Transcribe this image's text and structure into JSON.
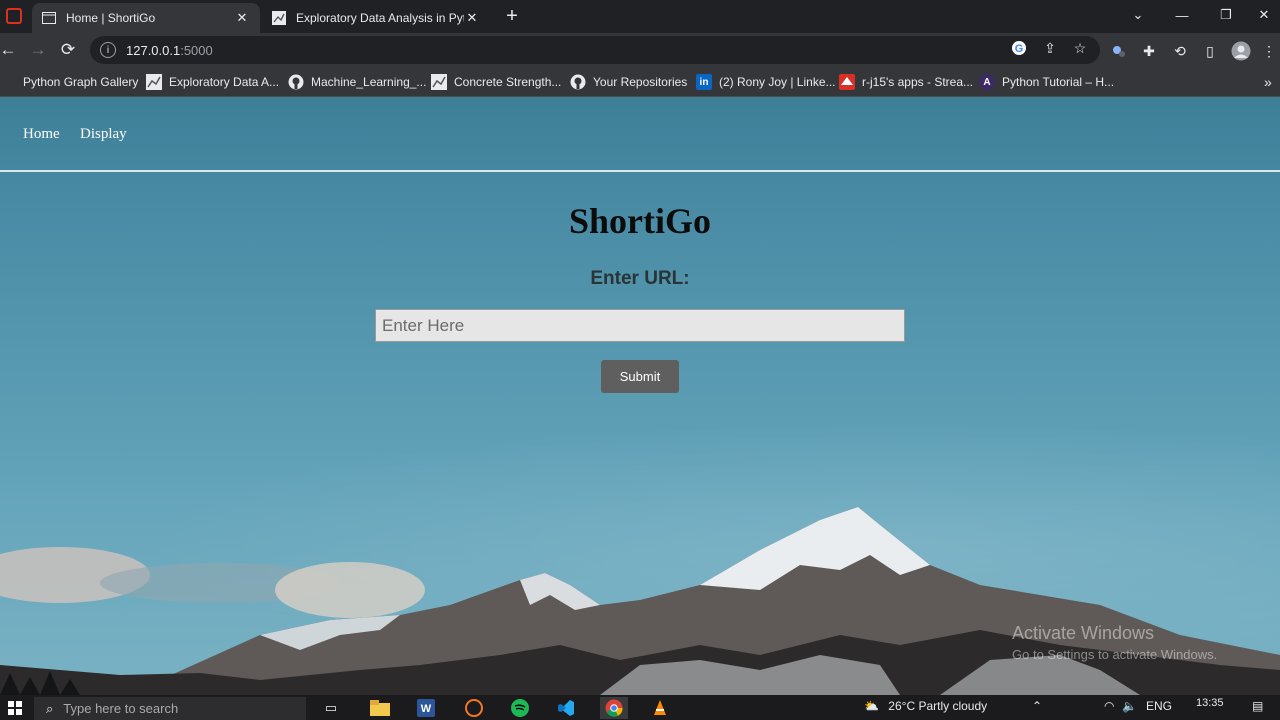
{
  "browser": {
    "tabs": [
      {
        "title": "Home | ShortiGo",
        "active": true
      },
      {
        "title": "Exploratory Data Analysis in Pyth",
        "active": false
      }
    ],
    "address": {
      "host": "127.0.0.1",
      "port": ":5000"
    },
    "bookmarks": [
      {
        "label": "Python Graph Gallery",
        "icon": "python-gallery-icon"
      },
      {
        "label": "Exploratory Data A...",
        "icon": "analytics-chart-icon"
      },
      {
        "label": "Machine_Learning_...",
        "icon": "github-icon"
      },
      {
        "label": "Concrete Strength...",
        "icon": "analytics-chart-icon"
      },
      {
        "label": "Your Repositories",
        "icon": "github-icon"
      },
      {
        "label": "(2) Rony Joy | Linke...",
        "icon": "linkedin-icon"
      },
      {
        "label": "r-j15's apps - Strea...",
        "icon": "streamlit-icon"
      },
      {
        "label": "Python Tutorial – H...",
        "icon": "python-tutorial-icon"
      }
    ]
  },
  "page": {
    "nav": {
      "home": "Home",
      "display": "Display"
    },
    "title": "ShortiGo",
    "url_label": "Enter URL:",
    "url_placeholder": "Enter Here",
    "submit_label": "Submit"
  },
  "watermark": {
    "line1": "Activate Windows",
    "line2": "Go to Settings to activate Windows."
  },
  "taskbar": {
    "search_placeholder": "Type here to search",
    "weather": "26°C  Partly cloudy",
    "lang": "ENG",
    "time": "13:35"
  },
  "colors": {
    "chrome_bg": "#202124",
    "toolbar_bg": "#35363a",
    "button_bg": "#5f5f5f",
    "input_bg": "#e6e6e6"
  }
}
